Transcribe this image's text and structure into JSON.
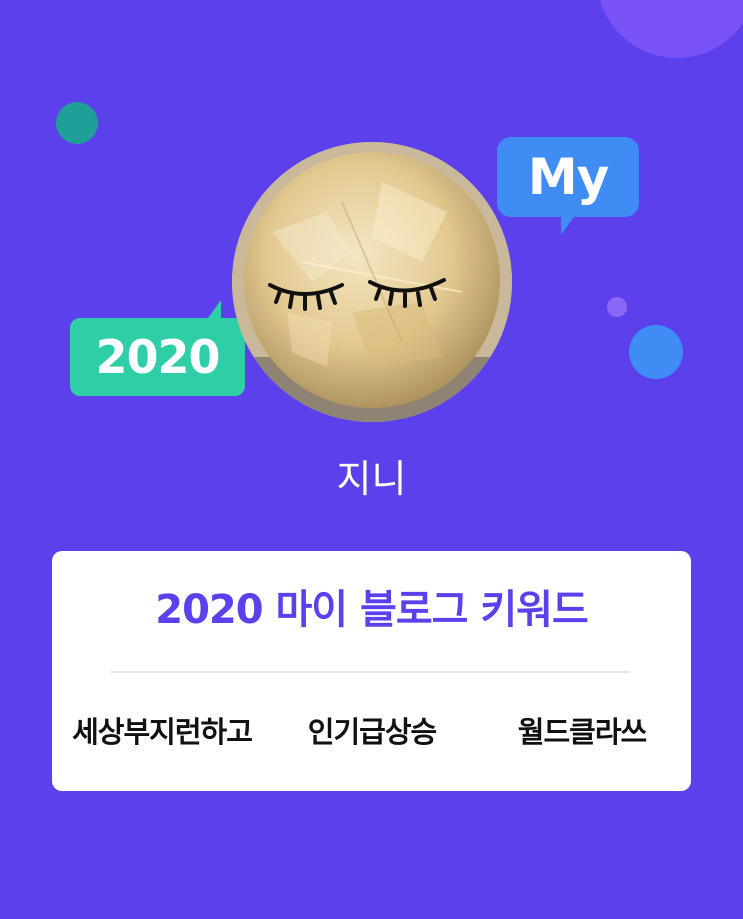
{
  "profile": {
    "name": "지니",
    "avatar": "closed-eyes-stone-icon"
  },
  "badges": {
    "my": "My",
    "year": "2020"
  },
  "card": {
    "title": "2020 마이 블로그 키워드",
    "keywords": [
      "세상부지런하고",
      "인기급상승",
      "월드클라쓰"
    ]
  },
  "colors": {
    "background": "#5b40ec",
    "title": "#5b40ec",
    "my_bubble": "#3f8cf5",
    "year_bubble": "#2ecea6",
    "card": "#ffffff"
  }
}
